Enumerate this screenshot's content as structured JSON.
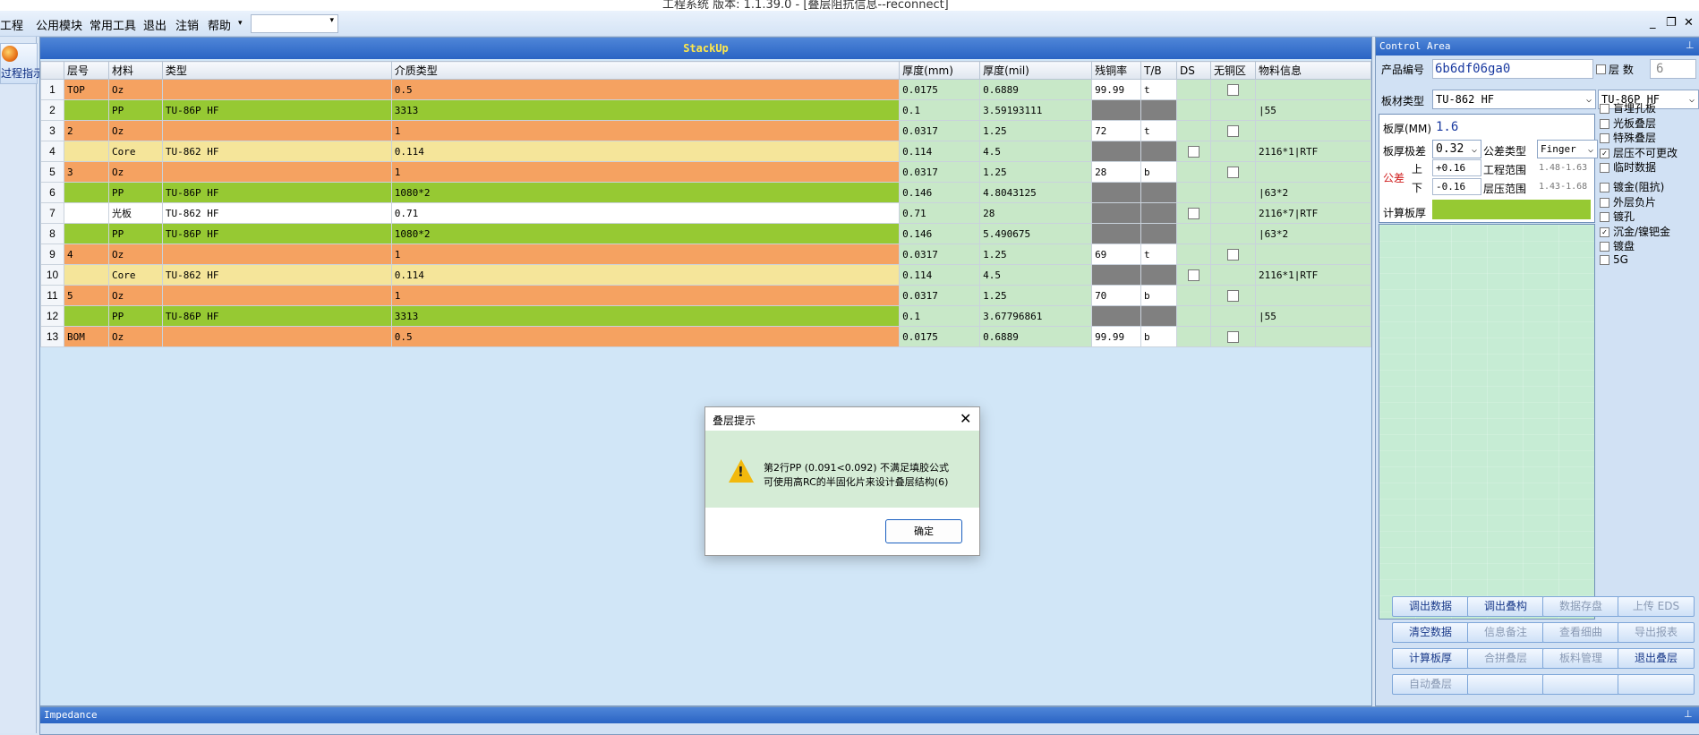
{
  "window": {
    "title": "工程系统  版本: 1.1.39.0 - [叠层阻抗信息--reconnect]"
  },
  "menu": {
    "items": [
      "工程",
      "公用模块",
      "常用工具",
      "退出",
      "注销",
      "帮助"
    ],
    "help_arrow": "▾",
    "combo_value": ""
  },
  "left": {
    "button_label": "过程指示"
  },
  "stackup": {
    "title": "StackUp",
    "columns": [
      "",
      "层号",
      "材料",
      "类型",
      "介质类型",
      "厚度(mm)",
      "厚度(mil)",
      "残铜率",
      "T/B",
      "DS",
      "无铜区",
      "物料信息"
    ],
    "rows": [
      {
        "n": "1",
        "layer": "TOP",
        "mat": "Oz",
        "type": "",
        "medium": "0.5",
        "mm": "0.0175",
        "mil": "0.6889",
        "rc": "99.99",
        "tb": "t",
        "ds": "",
        "nocu": "box",
        "info": "",
        "kind": "cu"
      },
      {
        "n": "2",
        "layer": "",
        "mat": "PP",
        "type": "TU-86P HF",
        "medium": "3313",
        "mm": "0.1",
        "mil": "3.59193111",
        "rc": "",
        "tb": "",
        "ds": "",
        "nocu": "",
        "info": "|55",
        "kind": "pp"
      },
      {
        "n": "3",
        "layer": "2",
        "mat": "Oz",
        "type": "",
        "medium": "1",
        "mm": "0.0317",
        "mil": "1.25",
        "rc": "72",
        "tb": "t",
        "ds": "",
        "nocu": "box",
        "info": "",
        "kind": "cu"
      },
      {
        "n": "4",
        "layer": "",
        "mat": "Core",
        "type": "TU-862 HF",
        "medium": "0.114",
        "mm": "0.114",
        "mil": "4.5",
        "rc": "",
        "tb": "",
        "ds": "box",
        "nocu": "",
        "info": "2116*1|RTF",
        "kind": "core"
      },
      {
        "n": "5",
        "layer": "3",
        "mat": "Oz",
        "type": "",
        "medium": "1",
        "mm": "0.0317",
        "mil": "1.25",
        "rc": "28",
        "tb": "b",
        "ds": "",
        "nocu": "box",
        "info": "",
        "kind": "cu"
      },
      {
        "n": "6",
        "layer": "",
        "mat": "PP",
        "type": "TU-86P HF",
        "medium": "1080*2",
        "mm": "0.146",
        "mil": "4.8043125",
        "rc": "",
        "tb": "",
        "ds": "",
        "nocu": "",
        "info": "|63*2",
        "kind": "pp"
      },
      {
        "n": "7",
        "layer": "",
        "mat": "光板",
        "type": "TU-862 HF",
        "medium": "0.71",
        "mm": "0.71",
        "mil": "28",
        "rc": "",
        "tb": "",
        "ds": "box",
        "nocu": "",
        "info": "2116*7|RTF",
        "kind": "gb"
      },
      {
        "n": "8",
        "layer": "",
        "mat": "PP",
        "type": "TU-86P HF",
        "medium": "1080*2",
        "mm": "0.146",
        "mil": "5.490675",
        "rc": "",
        "tb": "",
        "ds": "",
        "nocu": "",
        "info": "|63*2",
        "kind": "pp"
      },
      {
        "n": "9",
        "layer": "4",
        "mat": "Oz",
        "type": "",
        "medium": "1",
        "mm": "0.0317",
        "mil": "1.25",
        "rc": "69",
        "tb": "t",
        "ds": "",
        "nocu": "box",
        "info": "",
        "kind": "cu"
      },
      {
        "n": "10",
        "layer": "",
        "mat": "Core",
        "type": "TU-862 HF",
        "medium": "0.114",
        "mm": "0.114",
        "mil": "4.5",
        "rc": "",
        "tb": "",
        "ds": "box",
        "nocu": "",
        "info": "2116*1|RTF",
        "kind": "core"
      },
      {
        "n": "11",
        "layer": "5",
        "mat": "Oz",
        "type": "",
        "medium": "1",
        "mm": "0.0317",
        "mil": "1.25",
        "rc": "70",
        "tb": "b",
        "ds": "",
        "nocu": "box",
        "info": "",
        "kind": "cu"
      },
      {
        "n": "12",
        "layer": "",
        "mat": "PP",
        "type": "TU-86P HF",
        "medium": "3313",
        "mm": "0.1",
        "mil": "3.67796861",
        "rc": "",
        "tb": "",
        "ds": "",
        "nocu": "",
        "info": "|55",
        "kind": "pp"
      },
      {
        "n": "13",
        "layer": "BOM",
        "mat": "Oz",
        "type": "",
        "medium": "0.5",
        "mm": "0.0175",
        "mil": "0.6889",
        "rc": "99.99",
        "tb": "b",
        "ds": "",
        "nocu": "box",
        "info": "",
        "kind": "cu"
      }
    ]
  },
  "dialog": {
    "title": "叠层提示",
    "close": "✕",
    "line1": "第2行PP (0.091<0.092) 不满足填胶公式",
    "line2": "可使用高RC的半固化片来设计叠层结构(6)",
    "ok": "确定"
  },
  "control": {
    "title": "Control Area",
    "pin": "ᵖ",
    "product_label": "产品编号",
    "product_value": "6b6df06ga0",
    "layers_label": "层  数",
    "layers_value": "6",
    "board_type_label": "板材类型",
    "board_type_value": "TU-862 HF",
    "board_type2_value": "TU-86P HF",
    "thickness_label": "板厚(MM)",
    "thickness_value": "1.6",
    "extreme_label": "板厚极差",
    "extreme_value": "0.32",
    "tol_type_label": "公差类型",
    "tol_type_value": "Finger",
    "tol_label": "公差",
    "up_label": "上",
    "down_label": "下",
    "tol_up": "+0.16",
    "tol_down": "-0.16",
    "eng_range_label": "工程范围",
    "eng_range_value": "1.48-1.63",
    "press_range_label": "层压范围",
    "press_range_value": "1.43-1.68",
    "calc_label": "计算板厚",
    "calc_value": "",
    "checks": [
      {
        "label": "盲埋孔板",
        "checked": false
      },
      {
        "label": "光板叠层",
        "checked": false
      },
      {
        "label": "特殊叠层",
        "checked": false
      },
      {
        "label": "层压不可更改",
        "checked": true
      },
      {
        "label": "临时数据",
        "checked": false
      },
      {
        "label": "镀金(阻抗)",
        "checked": false
      },
      {
        "label": "外层负片",
        "checked": false
      },
      {
        "label": "镀孔",
        "checked": false
      },
      {
        "label": "沉金/镍钯金",
        "checked": true
      },
      {
        "label": "镀盘",
        "checked": false
      },
      {
        "label": "5G",
        "checked": false
      }
    ],
    "buttons": [
      {
        "label": "调出数据",
        "enabled": true
      },
      {
        "label": "调出叠构",
        "enabled": true
      },
      {
        "label": "数据存盘",
        "enabled": false
      },
      {
        "label": "上传 EDS",
        "enabled": false
      },
      {
        "label": "清空数据",
        "enabled": true
      },
      {
        "label": "信息备注",
        "enabled": false
      },
      {
        "label": "查看细曲",
        "enabled": false
      },
      {
        "label": "导出报表",
        "enabled": false
      },
      {
        "label": "计算板厚",
        "enabled": true
      },
      {
        "label": "合拼叠层",
        "enabled": false
      },
      {
        "label": "板料管理",
        "enabled": false
      },
      {
        "label": "退出叠层",
        "enabled": true
      },
      {
        "label": "自动叠层",
        "enabled": false
      },
      {
        "label": "",
        "enabled": false
      },
      {
        "label": "",
        "enabled": false
      },
      {
        "label": "",
        "enabled": false
      }
    ]
  },
  "impedance": {
    "title": "Impedance",
    "pin": "ᵖ"
  },
  "colors": {
    "copper": "#f5a261",
    "pp": "#96c933",
    "core": "#f5e59a",
    "cell_green": "#c8e8c8",
    "header_blue": "#2a64c4"
  }
}
